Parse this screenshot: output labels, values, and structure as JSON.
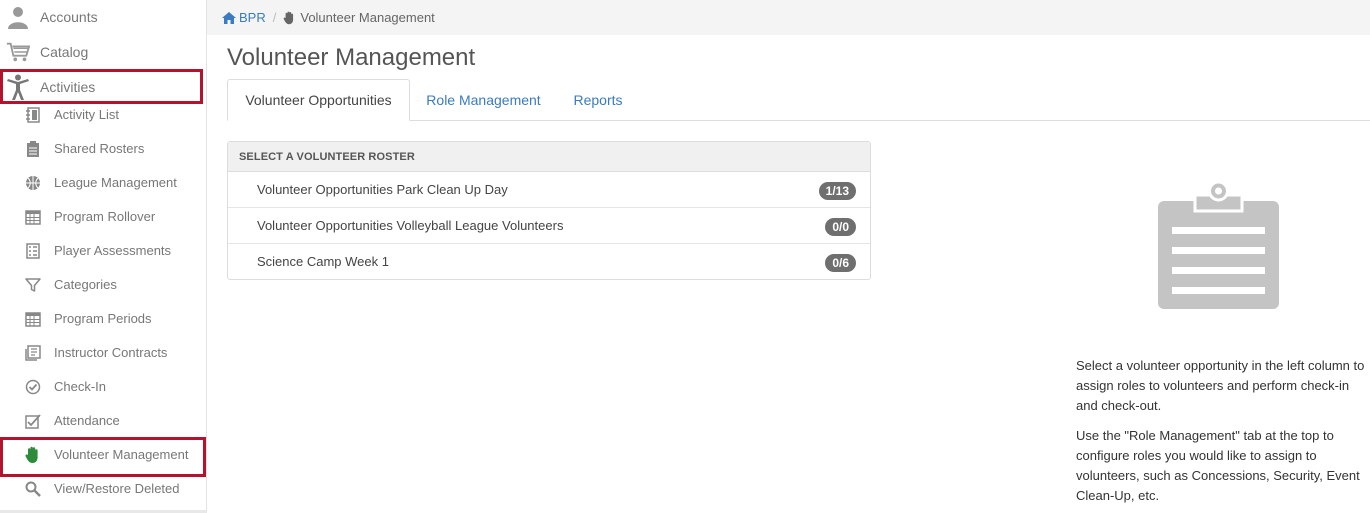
{
  "sidebar": {
    "top_items": [
      {
        "label": "Accounts",
        "icon": "person-icon"
      },
      {
        "label": "Catalog",
        "icon": "cart-icon"
      },
      {
        "label": "Activities",
        "icon": "activity-figure-icon"
      }
    ],
    "sub_items": [
      {
        "label": "Activity List",
        "icon": "notebook-icon"
      },
      {
        "label": "Shared Rosters",
        "icon": "clipboard-icon"
      },
      {
        "label": "League Management",
        "icon": "basketball-icon"
      },
      {
        "label": "Program Rollover",
        "icon": "calendar-grid-icon"
      },
      {
        "label": "Player Assessments",
        "icon": "assessment-icon"
      },
      {
        "label": "Categories",
        "icon": "filter-icon"
      },
      {
        "label": "Program Periods",
        "icon": "calendar-grid-icon"
      },
      {
        "label": "Instructor Contracts",
        "icon": "contract-icon"
      },
      {
        "label": "Check-In",
        "icon": "check-circle-icon"
      },
      {
        "label": "Attendance",
        "icon": "attendance-icon"
      },
      {
        "label": "Volunteer Management",
        "icon": "hand-icon"
      },
      {
        "label": "View/Restore Deleted",
        "icon": "magnifier-icon"
      }
    ]
  },
  "breadcrumb": {
    "home": "BPR",
    "current": "Volunteer Management"
  },
  "page": {
    "title": "Volunteer Management"
  },
  "tabs": [
    {
      "label": "Volunteer Opportunities",
      "active": true
    },
    {
      "label": "Role Management",
      "active": false
    },
    {
      "label": "Reports",
      "active": false
    }
  ],
  "roster": {
    "header": "SELECT A VOLUNTEER ROSTER",
    "rows": [
      {
        "name": "Volunteer Opportunities Park Clean Up Day",
        "count": "1/13"
      },
      {
        "name": "Volunteer Opportunities Volleyball League Volunteers",
        "count": "0/0"
      },
      {
        "name": "Science Camp Week 1",
        "count": "0/6"
      }
    ]
  },
  "info": {
    "p1": "Select a volunteer opportunity in the left column to assign roles to volunteers and perform check-in and check-out.",
    "p2": "Use the \"Role Management\" tab at the top to configure roles you would like to assign to volunteers, such as Concessions, Security, Event Clean-Up, etc."
  },
  "colors": {
    "link": "#3b7bbf",
    "highlight": "#b5122d",
    "badge": "#6f6f6f",
    "active_icon": "#2e8b3a"
  }
}
